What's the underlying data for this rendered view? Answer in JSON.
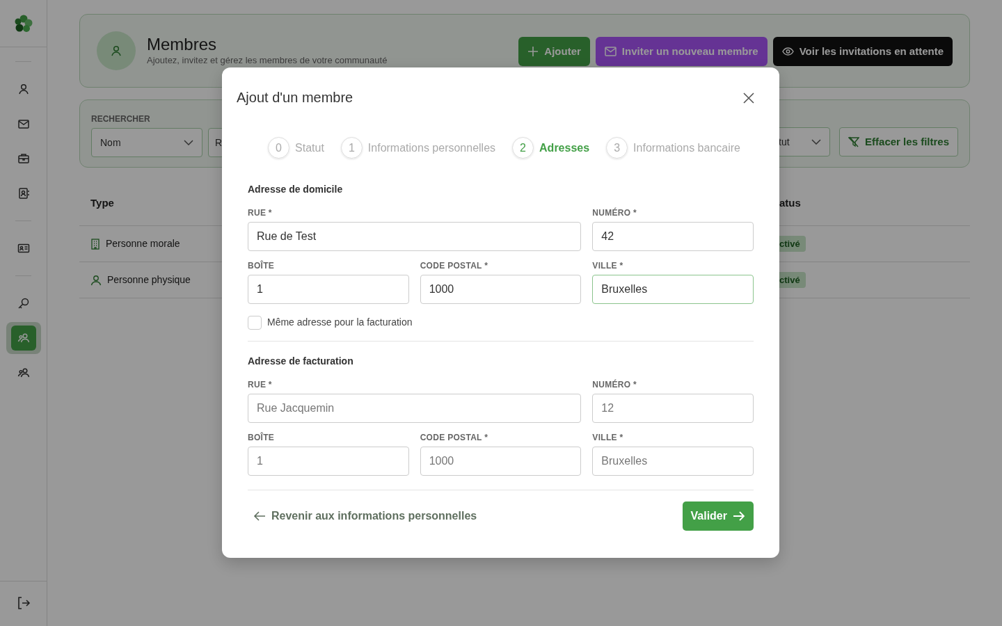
{
  "sidebar": {
    "groups": [
      {
        "items": [
          {
            "selected": false
          },
          {
            "selected": false
          },
          {
            "selected": false
          },
          {
            "selected": false
          }
        ]
      },
      {
        "items": [
          {
            "selected": false
          }
        ]
      },
      {
        "items": [
          {
            "selected": false
          },
          {
            "selected": true
          },
          {
            "selected": false
          }
        ]
      }
    ]
  },
  "header": {
    "title": "Membres",
    "subtitle": "Ajoutez, invitez et gérez les membres de votre communauté",
    "buttons": [
      {
        "label": "Ajouter",
        "kind": "add"
      },
      {
        "label": "Inviter un nouveau membre",
        "kind": "invite"
      },
      {
        "label": "Voir les invitations en attente",
        "kind": "view"
      }
    ]
  },
  "filters": {
    "label": "RECHERCHER",
    "search_by": "Nom",
    "field_2": "R",
    "status_select": "tut",
    "clear_button": "Effacer les filtres"
  },
  "table": {
    "columns": [
      "Type",
      "atus"
    ],
    "rows": [
      {
        "type": "Personne morale",
        "kind": "company",
        "status": "ctivé"
      },
      {
        "type": "Personne physique",
        "kind": "person",
        "status": "ctivé"
      }
    ]
  },
  "modal": {
    "title": "Ajout d'un membre",
    "steps": [
      {
        "number": "0",
        "label": "Statut",
        "selected": false
      },
      {
        "number": "1",
        "label": "Informations personnelles",
        "selected": false
      },
      {
        "number": "2",
        "label": "Adresses",
        "selected": true
      },
      {
        "number": "3",
        "label": "Informations bancaire",
        "selected": false
      }
    ],
    "sections": [
      {
        "title": "Adresse de domicile",
        "fields": [
          {
            "label": "RUE *",
            "value": "Rue de Test",
            "focused": false
          },
          {
            "label": "NUMÉRO *",
            "value": "42",
            "focused": false
          },
          {
            "label": "BOÎTE",
            "value": "1",
            "focused": false
          },
          {
            "label": "CODE POSTAL *",
            "value": "1000",
            "focused": false
          },
          {
            "label": "VILLE *",
            "value": "Bruxelles",
            "focused": true
          }
        ],
        "checkbox": {
          "label": "Même adresse pour la facturation",
          "checked": false
        }
      },
      {
        "title": "Adresse de facturation",
        "fields": [
          {
            "label": "RUE *",
            "placeholder": "Rue Jacquemin",
            "focused": false
          },
          {
            "label": "NUMÉRO *",
            "placeholder": "12",
            "focused": false
          },
          {
            "label": "BOÎTE",
            "placeholder": "1",
            "focused": false
          },
          {
            "label": "CODE POSTAL *",
            "placeholder": "1000",
            "focused": false
          },
          {
            "label": "VILLE *",
            "placeholder": "Bruxelles",
            "focused": false
          }
        ]
      }
    ],
    "back_link": "Revenir aux informations personnelles",
    "submit_button": "Valider"
  }
}
